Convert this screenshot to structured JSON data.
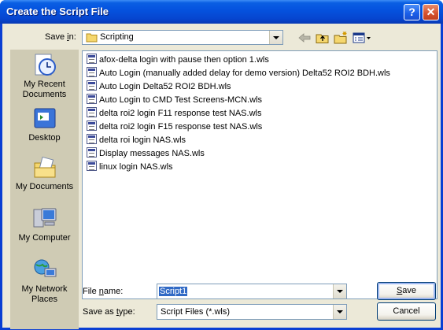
{
  "window": {
    "title": "Create the Script File",
    "help_label": "?",
    "close_label": "✕"
  },
  "save_in": {
    "label_pre": "Save ",
    "label_key": "i",
    "label_post": "n:",
    "value": "Scripting"
  },
  "places": [
    {
      "label": "My Recent Documents",
      "icon": "recent-documents-icon"
    },
    {
      "label": "Desktop",
      "icon": "desktop-icon"
    },
    {
      "label": "My Documents",
      "icon": "my-documents-icon"
    },
    {
      "label": "My Computer",
      "icon": "my-computer-icon"
    },
    {
      "label": "My Network Places",
      "icon": "network-places-icon"
    }
  ],
  "files": [
    "afox-delta login with pause then option 1.wls",
    "Auto Login (manually added delay for demo version) Delta52 ROI2 BDH.wls",
    "Auto Login Delta52 ROI2 BDH.wls",
    "Auto Login to CMD Test Screens-MCN.wls",
    "delta roi2 login F11 response test NAS.wls",
    "delta roi2 login F15 response test NAS.wls",
    "delta roi login NAS.wls",
    "Display messages NAS.wls",
    "linux login NAS.wls"
  ],
  "file_name": {
    "label_pre": "File ",
    "label_key": "n",
    "label_post": "ame:",
    "value": "Script1"
  },
  "save_as_type": {
    "label_pre": "Save as ",
    "label_key": "t",
    "label_post": "ype:",
    "value": "Script Files (*.wls)"
  },
  "buttons": {
    "save_key": "S",
    "save_rest": "ave",
    "cancel": "Cancel"
  },
  "toolbar_icons": [
    "back-arrow-icon",
    "up-folder-icon",
    "new-folder-icon",
    "views-menu-icon"
  ],
  "colors": {
    "titlebar": "#0553df",
    "dialog_bg": "#ece9d8",
    "places_bg": "#cfcbb4",
    "selection": "#316ac5"
  }
}
